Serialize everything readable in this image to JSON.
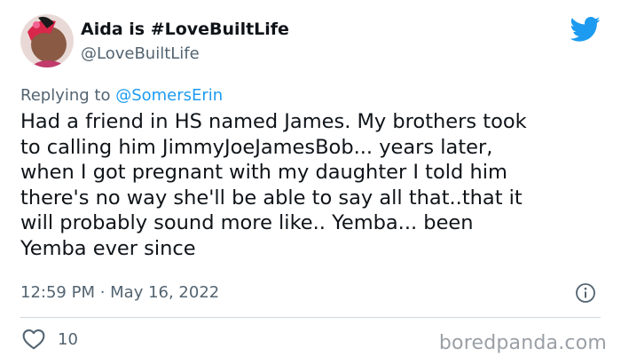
{
  "author": {
    "display_name": "Aida is #LoveBuiltLife",
    "handle": "@LoveBuiltLife"
  },
  "reply": {
    "prefix": "Replying to ",
    "mention": "@SomersErin"
  },
  "tweet": {
    "text": "Had a friend in HS named James. My brothers took\nto calling him JimmyJoeJamesBob... years later,\nwhen I got pregnant with my daughter I told him\nthere's no way she'll be able to say all that..that it\nwill probably sound more like.. Yemba... been\nYemba ever since",
    "timestamp": "12:59 PM · May 16, 2022"
  },
  "stats": {
    "likes": "10"
  },
  "watermark": "boredpanda.com",
  "colors": {
    "twitter_blue": "#1d9bf0",
    "secondary_text": "#536471",
    "primary_text": "#0f1419"
  },
  "icons": {
    "brand": "twitter-bird-icon",
    "info": "info-icon",
    "like": "heart-icon"
  }
}
